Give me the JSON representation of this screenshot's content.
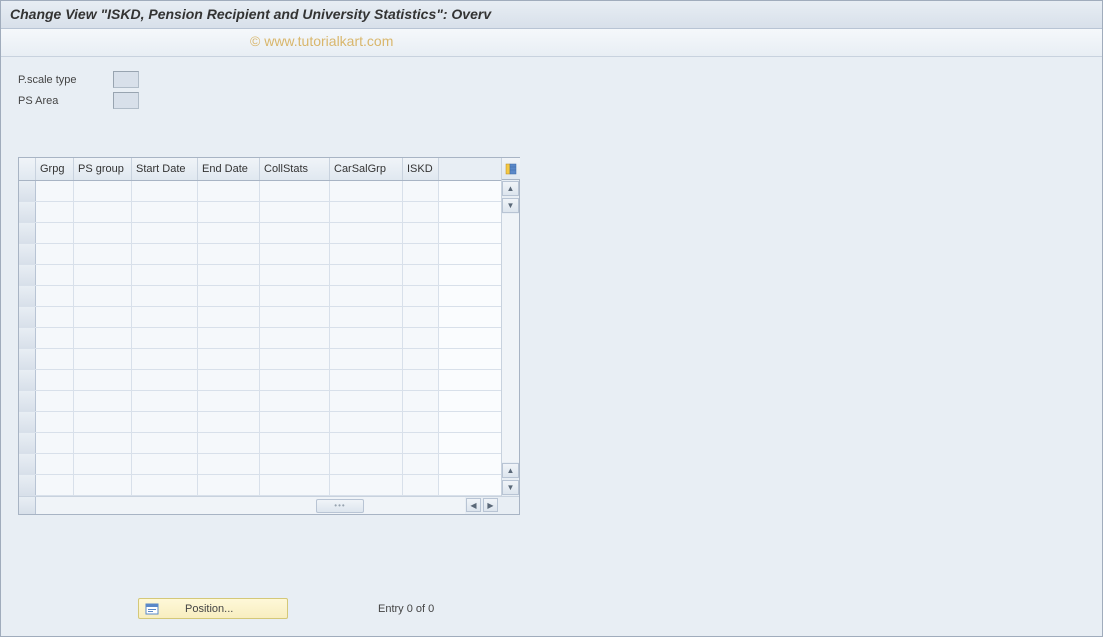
{
  "title": "Change View \"ISKD, Pension Recipient and University Statistics\": Overv",
  "watermark": "© www.tutorialkart.com",
  "form": {
    "pscale_type_label": "P.scale type",
    "pscale_type_value": "",
    "ps_area_label": "PS Area",
    "ps_area_value": ""
  },
  "table": {
    "columns": [
      {
        "key": "grpg",
        "label": "Grpg"
      },
      {
        "key": "psgroup",
        "label": "PS group"
      },
      {
        "key": "startdate",
        "label": "Start Date"
      },
      {
        "key": "enddate",
        "label": "End Date"
      },
      {
        "key": "collstats",
        "label": "CollStats"
      },
      {
        "key": "carsalgrp",
        "label": "CarSalGrp"
      },
      {
        "key": "iskd",
        "label": "ISKD"
      }
    ],
    "rows": [
      {},
      {},
      {},
      {},
      {},
      {},
      {},
      {},
      {},
      {},
      {},
      {},
      {},
      {},
      {}
    ]
  },
  "footer": {
    "position_label": "Position...",
    "entry_text": "Entry 0 of 0"
  }
}
